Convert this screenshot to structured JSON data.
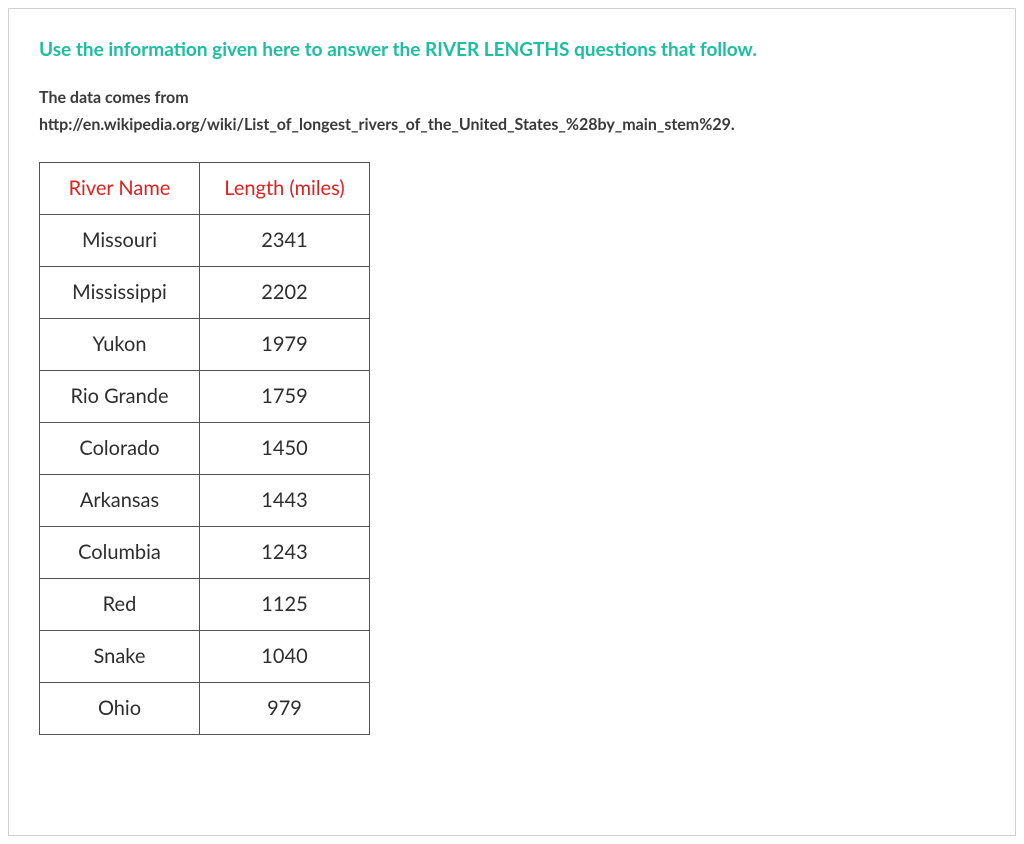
{
  "instruction": "Use the information given here to answer the RIVER LENGTHS questions that follow.",
  "source_intro": "The data comes from",
  "source_url": "http://en.wikipedia.org/wiki/List_of_longest_rivers_of_the_United_States_%28by_main_stem%29.",
  "table": {
    "headers": {
      "name": "River Name",
      "length": "Length (miles)"
    },
    "rows": [
      {
        "name": "Missouri",
        "length": "2341"
      },
      {
        "name": "Mississippi",
        "length": "2202"
      },
      {
        "name": "Yukon",
        "length": "1979"
      },
      {
        "name": "Rio Grande",
        "length": "1759"
      },
      {
        "name": "Colorado",
        "length": "1450"
      },
      {
        "name": "Arkansas",
        "length": "1443"
      },
      {
        "name": "Columbia",
        "length": "1243"
      },
      {
        "name": "Red",
        "length": "1125"
      },
      {
        "name": "Snake",
        "length": "1040"
      },
      {
        "name": "Ohio",
        "length": "979"
      }
    ]
  }
}
